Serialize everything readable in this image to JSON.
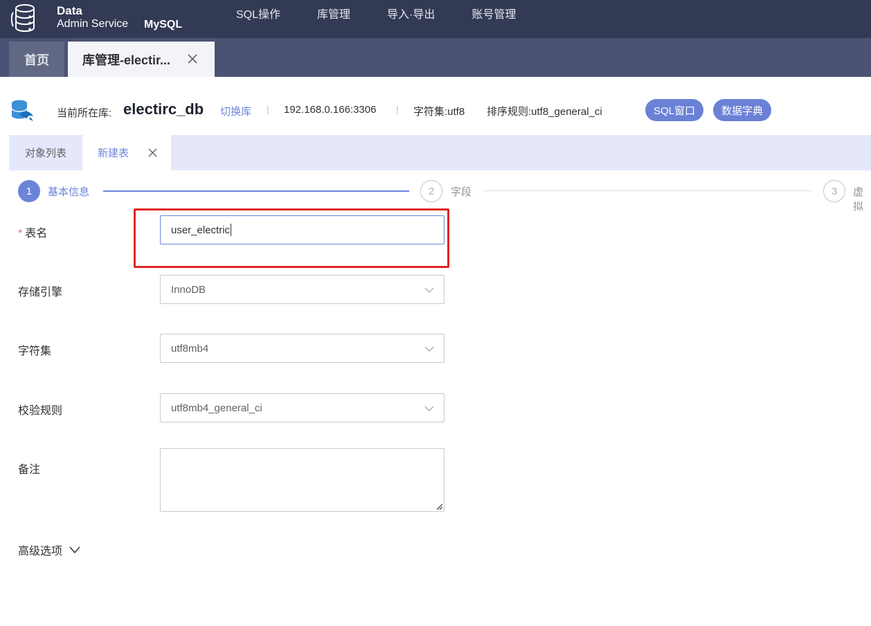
{
  "header": {
    "logo_line1": "Data",
    "logo_line2": "Admin Service",
    "db_type": "MySQL",
    "nav": [
      "SQL操作",
      "库管理",
      "导入·导出",
      "账号管理"
    ]
  },
  "page_tabs": {
    "home": "首页",
    "active": "库管理-electir..."
  },
  "db_info": {
    "current_label": "当前所在库:",
    "db_name": "electirc_db",
    "switch_label": "切换库",
    "separator": "|",
    "host": "192.168.0.166:3306",
    "charset": "字符集:utf8",
    "collation": "排序规则:utf8_general_ci",
    "sql_window_button": "SQL窗口",
    "data_dict_button": "数据字典"
  },
  "sub_tabs": {
    "object_list": "对象列表",
    "new_table": "新建表"
  },
  "steps": [
    {
      "num": "1",
      "label": "基本信息"
    },
    {
      "num": "2",
      "label": "字段"
    },
    {
      "num": "3",
      "label": "虚拟"
    }
  ],
  "form": {
    "required_mark": "*",
    "table_name_label": "表名",
    "table_name_value": "user_electric",
    "engine_label": "存储引擎",
    "engine_value": "InnoDB",
    "charset_label": "字符集",
    "charset_value": "utf8mb4",
    "collation_label": "校验规则",
    "collation_value": "utf8mb4_general_ci",
    "comment_label": "备注",
    "comment_value": "",
    "advanced_label": "高级选项"
  },
  "colors": {
    "topbar": "#333a54",
    "tabstrip": "#4b5273",
    "accent": "#6b84d9",
    "highlight": "#e02424"
  }
}
